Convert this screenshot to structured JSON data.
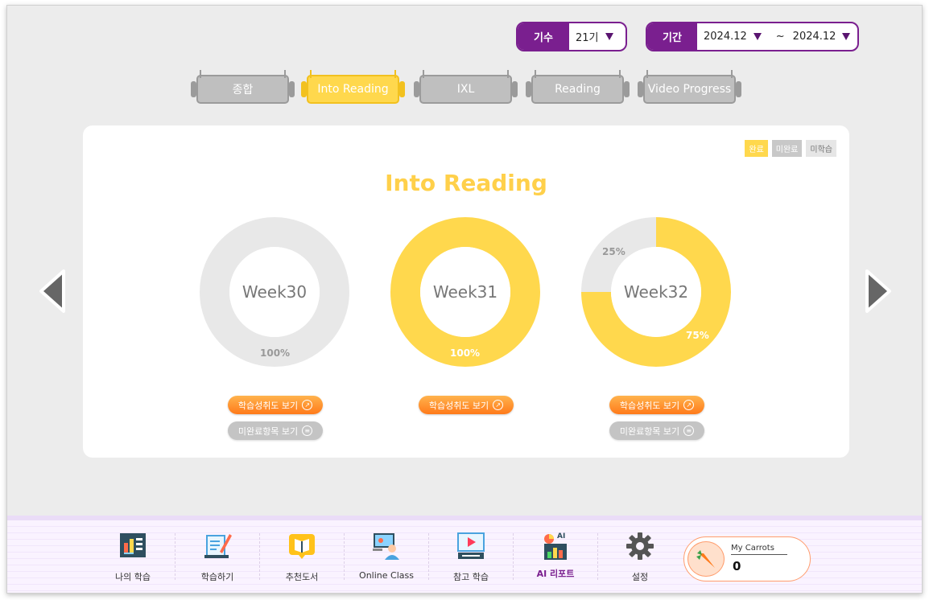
{
  "filters": {
    "gisu": {
      "label": "기수",
      "value": "21기"
    },
    "period": {
      "label": "기간",
      "start": "2024.12",
      "separator": "~",
      "end": "2024.12"
    }
  },
  "tabs": [
    {
      "label": "종합",
      "active": false
    },
    {
      "label": "Into Reading",
      "active": true
    },
    {
      "label": "IXL",
      "active": false
    },
    {
      "label": "Reading",
      "active": false
    },
    {
      "label": "Video Progress",
      "active": false
    }
  ],
  "legend": {
    "done": "완료",
    "undone": "미완료",
    "not_studied": "미학습"
  },
  "card": {
    "title": "Into Reading"
  },
  "weeks": [
    {
      "label": "Week30",
      "done_pct": 0,
      "not_studied_pct": 100,
      "pct_labels": [
        "100%"
      ],
      "achievement_button": "학습성취도 보기",
      "incomplete_button": "미완료항목 보기"
    },
    {
      "label": "Week31",
      "done_pct": 100,
      "not_studied_pct": 0,
      "pct_labels": [
        "100%"
      ],
      "achievement_button": "학습성취도 보기"
    },
    {
      "label": "Week32",
      "done_pct": 75,
      "not_studied_pct": 25,
      "pct_labels": [
        "25%",
        "75%"
      ],
      "achievement_button": "학습성취도 보기",
      "incomplete_button": "미완료항목 보기"
    }
  ],
  "colors": {
    "done": "#ffd84d",
    "not_studied": "#e8e8e8",
    "accent": "#7a1f8f",
    "title": "#ffd04a"
  },
  "nav": [
    {
      "label": "나의 학습",
      "icon": "my-study-icon"
    },
    {
      "label": "학습하기",
      "icon": "study-notebook-icon"
    },
    {
      "label": "추천도서",
      "icon": "recommended-book-icon"
    },
    {
      "label": "Online Class",
      "icon": "online-class-icon"
    },
    {
      "label": "참고 학습",
      "icon": "reference-video-icon"
    },
    {
      "label": "AI 리포트",
      "icon": "ai-report-icon",
      "active": true
    },
    {
      "label": "설정",
      "icon": "gear-icon"
    }
  ],
  "carrots": {
    "label": "My Carrots",
    "value": "0"
  }
}
